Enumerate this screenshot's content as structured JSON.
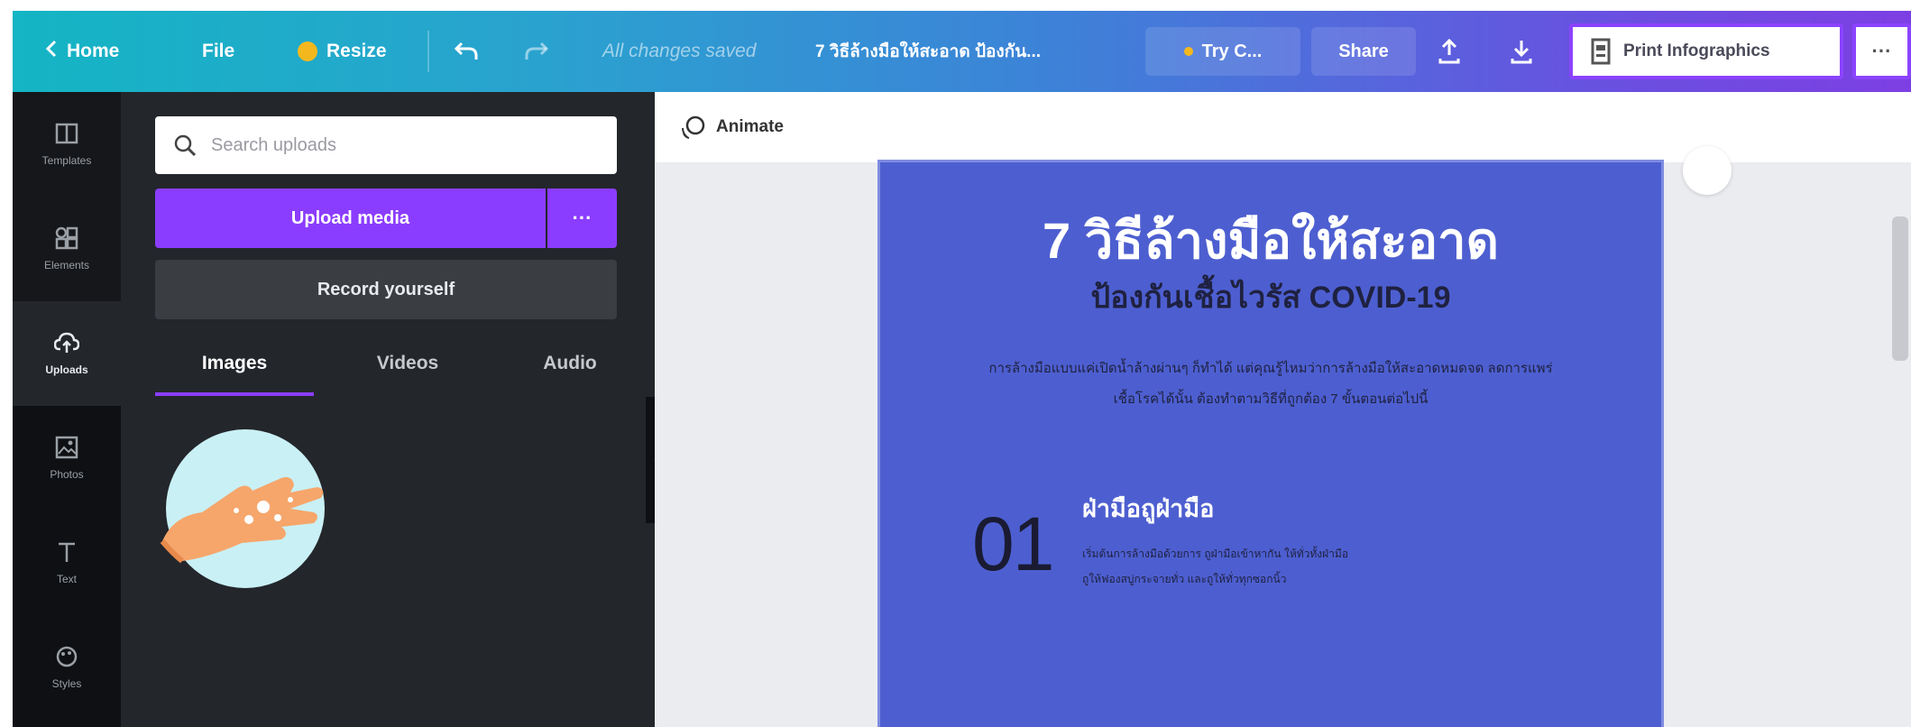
{
  "topbar": {
    "home": "Home",
    "file": "File",
    "resize": "Resize",
    "save_status": "All changes saved",
    "doc_title": "7 วิธีล้างมือให้สะอาด ป้องกัน...",
    "try_label": "Try C...",
    "share": "Share",
    "print": "Print Infographics",
    "more": "···"
  },
  "rail": {
    "items": [
      {
        "label": "Templates",
        "icon": "templates-icon"
      },
      {
        "label": "Elements",
        "icon": "elements-icon"
      },
      {
        "label": "Uploads",
        "icon": "uploads-icon"
      },
      {
        "label": "Photos",
        "icon": "photos-icon"
      },
      {
        "label": "Text",
        "icon": "text-icon"
      },
      {
        "label": "Styles",
        "icon": "styles-icon"
      }
    ]
  },
  "uploads": {
    "search_placeholder": "Search uploads",
    "upload_media": "Upload media",
    "upload_more": "···",
    "record": "Record yourself",
    "tabs": [
      "Images",
      "Videos",
      "Audio"
    ],
    "active_tab": "Images"
  },
  "canvas": {
    "animate": "Animate",
    "title": "7 วิธีล้างมือให้สะอาด",
    "subtitle": "ป้องกันเชื้อไวรัส COVID-19",
    "intro": "การล้างมือแบบแค่เปิดน้ำล้างผ่านๆ ก็ทำได้ แต่คุณรู้ไหมว่าการล้างมือให้สะอาดหมดจด ลดการแพร่เชื้อโรคได้นั้น ต้องทำตามวิธีที่ถูกต้อง 7 ขั้นตอนต่อไปนี้",
    "step_number": "01",
    "step_title": "ฝ่ามือถูฝ่ามือ",
    "step_desc": "เริ่มต้นการล้างมือด้วยการ ถูฝ่ามือเข้าหากัน ให้ทั่วทั้งฝ่ามือ ถูให้ฟองสบู่กระจายทั่ว และถูให้ทั่วทุกซอกนิ้ว"
  },
  "colors": {
    "accent": "#8b3dff",
    "page_bg": "#4d5fd0",
    "panel_bg": "#23262b"
  }
}
